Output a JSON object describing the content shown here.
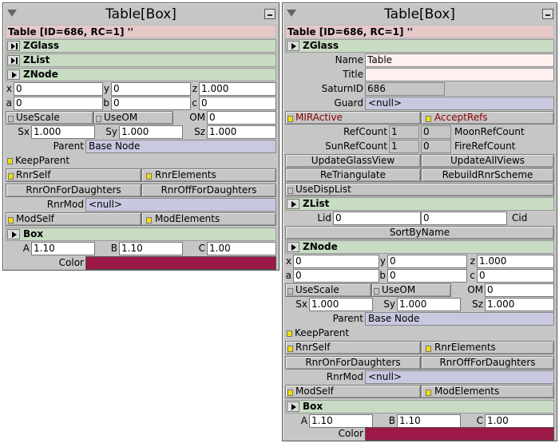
{
  "left": {
    "window_title": "Table[Box]",
    "header": "Table [ID=686, RC=1] ''",
    "sections": {
      "zglass": "ZGlass",
      "zlist": "ZList",
      "znode": "ZNode",
      "box": "Box"
    },
    "znode": {
      "x": "0",
      "y": "0",
      "z": "1.000",
      "a": "0",
      "b": "0",
      "c": "0",
      "use_scale": "UseScale",
      "use_om": "UseOM",
      "om_label": "OM",
      "om": "0",
      "sx": "1.000",
      "sy": "1.000",
      "sz": "1.000",
      "parent_label": "Parent",
      "parent": "Base Node",
      "keep_parent": "KeepParent",
      "rnr_self": "RnrSelf",
      "rnr_elements": "RnrElements",
      "rnr_on_daughters": "RnrOnForDaughters",
      "rnr_off_daughters": "RnrOffForDaughters",
      "rnr_mod_label": "RnrMod",
      "rnr_mod": "<null>",
      "mod_self": "ModSelf",
      "mod_elements": "ModElements"
    },
    "box": {
      "a": "1.10",
      "b": "1.10",
      "c": "1.00",
      "color_label": "Color",
      "color": "#9c1848"
    }
  },
  "right": {
    "window_title": "Table[Box]",
    "header": "Table [ID=686, RC=1] ''",
    "sections": {
      "zglass": "ZGlass",
      "zlist": "ZList",
      "znode": "ZNode",
      "box": "Box"
    },
    "zglass": {
      "name_label": "Name",
      "name": "Table",
      "title_label": "Title",
      "title": "",
      "saturnid_label": "SaturnID",
      "saturnid": "686",
      "guard_label": "Guard",
      "guard": "<null>",
      "mir_active": "MIRActive",
      "accept_refs": "AcceptRefs",
      "refcount_label": "RefCount",
      "refcount": "1",
      "refcount2": "0",
      "moonrefcount_label": "MoonRefCount",
      "sunrefcount_label": "SunRefCount",
      "sunrefcount": "1",
      "sunrefcount2": "0",
      "firerefcount_label": "FireRefCount",
      "update_glass_view": "UpdateGlassView",
      "update_all_views": "UpdateAllViews",
      "retriangulate": "ReTriangulate",
      "rebuild_rnr_scheme": "RebuildRnrScheme",
      "use_disp_list": "UseDispList"
    },
    "zlist": {
      "lid_label": "Lid",
      "lid": "0",
      "cid_value": "0",
      "cid_label": "Cid",
      "sort_by_name": "SortByName"
    },
    "znode": {
      "x": "0",
      "y": "0",
      "z": "1.000",
      "a": "0",
      "b": "0",
      "c": "0",
      "use_scale": "UseScale",
      "use_om": "UseOM",
      "om_label": "OM",
      "om": "0",
      "sx": "1.000",
      "sy": "1.000",
      "sz": "1.000",
      "parent_label": "Parent",
      "parent": "Base Node",
      "keep_parent": "KeepParent",
      "rnr_self": "RnrSelf",
      "rnr_elements": "RnrElements",
      "rnr_on_daughters": "RnrOnForDaughters",
      "rnr_off_daughters": "RnrOffForDaughters",
      "rnr_mod_label": "RnrMod",
      "rnr_mod": "<null>",
      "mod_self": "ModSelf",
      "mod_elements": "ModElements"
    },
    "box": {
      "a": "1.10",
      "b": "1.10",
      "c": "1.00",
      "color_label": "Color",
      "color": "#9c1848"
    }
  },
  "labels": {
    "x": "x",
    "y": "y",
    "z": "z",
    "a": "a",
    "b": "b",
    "c": "c",
    "sx": "Sx",
    "sy": "Sy",
    "sz": "Sz",
    "A": "A",
    "B": "B",
    "C": "C"
  }
}
